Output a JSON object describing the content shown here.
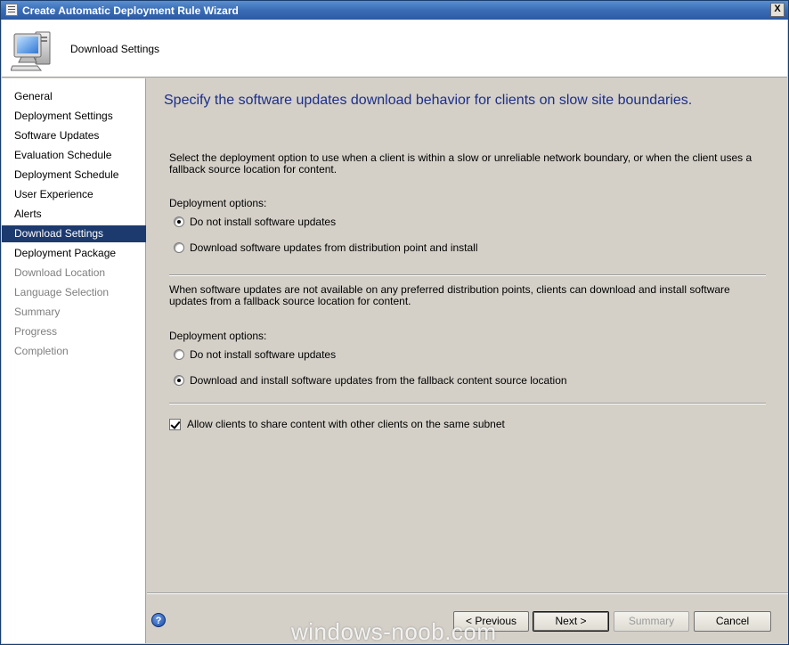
{
  "window": {
    "title": "Create Automatic Deployment Rule Wizard",
    "close_glyph": "X"
  },
  "header": {
    "title": "Download Settings"
  },
  "sidebar": {
    "items": [
      {
        "label": "General",
        "state": "done"
      },
      {
        "label": "Deployment Settings",
        "state": "done"
      },
      {
        "label": "Software Updates",
        "state": "done"
      },
      {
        "label": "Evaluation Schedule",
        "state": "done"
      },
      {
        "label": "Deployment Schedule",
        "state": "done"
      },
      {
        "label": "User Experience",
        "state": "done"
      },
      {
        "label": "Alerts",
        "state": "done"
      },
      {
        "label": "Download Settings",
        "state": "active"
      },
      {
        "label": "Deployment Package",
        "state": "done"
      },
      {
        "label": "Download Location",
        "state": "future"
      },
      {
        "label": "Language Selection",
        "state": "future"
      },
      {
        "label": "Summary",
        "state": "future"
      },
      {
        "label": "Progress",
        "state": "future"
      },
      {
        "label": "Completion",
        "state": "future"
      }
    ]
  },
  "main": {
    "heading": "Specify the software updates download behavior for clients on slow site boundaries.",
    "section1": {
      "description": "Select the deployment option to use when a client is within a slow or unreliable network boundary, or when the client uses a fallback source location for content.",
      "options_label": "Deployment options:",
      "options": [
        {
          "label": "Do not install software updates",
          "checked": true
        },
        {
          "label": "Download software updates from distribution point and install",
          "checked": false
        }
      ]
    },
    "section2": {
      "description": "When software updates are not available on any preferred distribution points, clients can download and install software updates from a fallback source location for content.",
      "options_label": "Deployment options:",
      "options": [
        {
          "label": "Do not install software updates",
          "checked": false
        },
        {
          "label": "Download and install software updates from the fallback content source location",
          "checked": true
        }
      ]
    },
    "share_checkbox": {
      "label": "Allow clients to share content with other clients on the same subnet",
      "checked": true
    }
  },
  "footer": {
    "help_glyph": "?",
    "previous_label": "< Previous",
    "next_label": "Next >",
    "summary_label": "Summary",
    "cancel_label": "Cancel"
  },
  "watermark": "windows-noob.com",
  "colors": {
    "heading": "#1c2e8c",
    "active_nav_bg": "#1c3a6e",
    "titlebar": "#3a6cb5",
    "dialog_bg": "#d4d0c8"
  }
}
